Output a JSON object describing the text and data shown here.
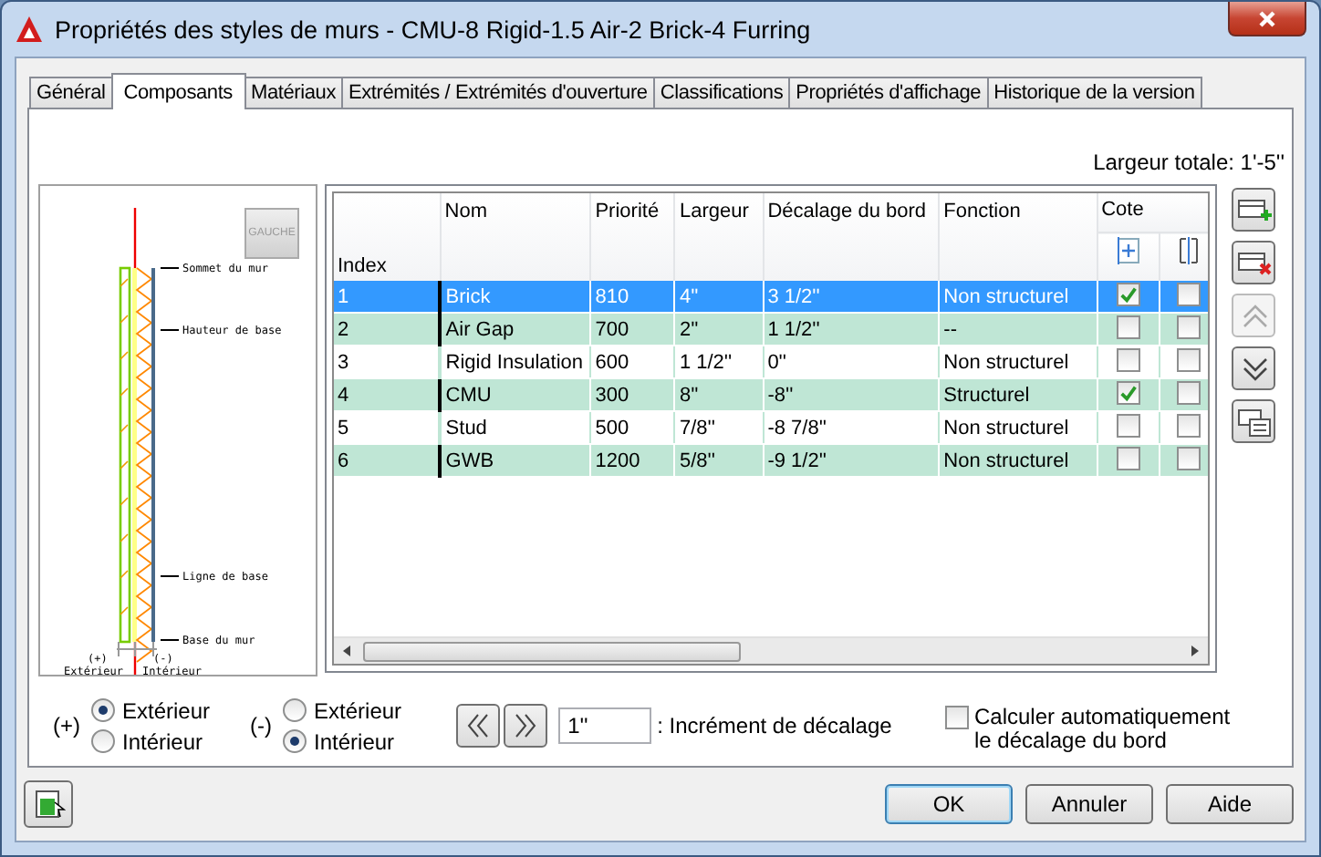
{
  "window": {
    "title": "Propriétés des styles de murs - CMU-8 Rigid-1.5 Air-2 Brick-4 Furring"
  },
  "tabs": [
    {
      "label": "Général",
      "selected": false
    },
    {
      "label": "Composants",
      "selected": true
    },
    {
      "label": "Matériaux",
      "selected": false
    },
    {
      "label": "Extrémités / Extrémités d'ouverture",
      "selected": false
    },
    {
      "label": "Classifications",
      "selected": false
    },
    {
      "label": "Propriétés d'affichage",
      "selected": false
    },
    {
      "label": "Historique de la version",
      "selected": false
    }
  ],
  "total_width": "Largeur totale: 1'-5''",
  "preview": {
    "side_button": "GAUCHE",
    "labels": [
      "Sommet du mur",
      "Hauteur de base",
      "Ligne de base",
      "Base du mur"
    ],
    "exterior_sign": "(+)",
    "exterior": "Extérieur",
    "interior_sign": "(-)",
    "interior": "Intérieur"
  },
  "table": {
    "columns": [
      "Index",
      "Nom",
      "Priorité",
      "Largeur",
      "Décalage du bord",
      "Fonction"
    ],
    "group_header": "Cote",
    "rows": [
      {
        "cells": [
          "1",
          "Brick",
          "810",
          "4''",
          "3 1/2''",
          "Non structurel"
        ],
        "cote_1": true,
        "cote_2": false,
        "selected": true
      },
      {
        "cells": [
          "2",
          "Air Gap",
          "700",
          "2''",
          "1 1/2''",
          "--"
        ],
        "cote_1": false,
        "cote_2": false,
        "selected": false
      },
      {
        "cells": [
          "3",
          "Rigid Insulation",
          "600",
          "1 1/2''",
          "0''",
          "Non structurel"
        ],
        "cote_1": false,
        "cote_2": false,
        "selected": false
      },
      {
        "cells": [
          "4",
          "CMU",
          "300",
          "8''",
          "-8''",
          "Structurel"
        ],
        "cote_1": true,
        "cote_2": false,
        "selected": false
      },
      {
        "cells": [
          "5",
          "Stud",
          "500",
          "7/8''",
          "-8 7/8''",
          "Non structurel"
        ],
        "cote_1": false,
        "cote_2": false,
        "selected": false
      },
      {
        "cells": [
          "6",
          "GWB",
          "1200",
          "5/8''",
          "-9 1/2''",
          "Non structurel"
        ],
        "cote_1": false,
        "cote_2": false,
        "selected": false
      }
    ]
  },
  "side_buttons": [
    {
      "kind": "add",
      "disabled": false
    },
    {
      "kind": "delete",
      "disabled": false
    },
    {
      "kind": "up",
      "disabled": true
    },
    {
      "kind": "down",
      "disabled": false
    },
    {
      "kind": "table",
      "disabled": false
    }
  ],
  "exterior_side": {
    "sign": "(+)",
    "options": [
      {
        "label": "Extérieur",
        "selected": true
      },
      {
        "label": "Intérieur",
        "selected": false
      }
    ]
  },
  "interior_side": {
    "sign": "(-)",
    "options": [
      {
        "label": "Extérieur",
        "selected": false
      },
      {
        "label": "Intérieur",
        "selected": true
      }
    ]
  },
  "offset_increment": {
    "value": "1''",
    "label": ": Incrément de décalage"
  },
  "auto_offset": {
    "label": "Calculer automatiquement le décalage du bord",
    "checked": false
  },
  "buttons": [
    {
      "label": "OK",
      "default": true
    },
    {
      "label": "Annuler",
      "default": false
    },
    {
      "label": "Aide",
      "default": false
    }
  ]
}
